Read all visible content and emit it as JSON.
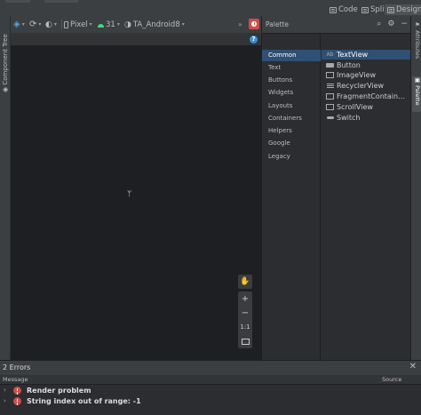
{
  "view_modes": {
    "code": "Code",
    "split": "Split",
    "design": "Design"
  },
  "toolbar": {
    "device": "Pixel",
    "api_level": "31",
    "theme": "TA_Android8",
    "overflow": "»"
  },
  "left_panel": {
    "label": "Component Tree"
  },
  "palette": {
    "title": "Palette",
    "categories": [
      "Common",
      "Text",
      "Buttons",
      "Widgets",
      "Layouts",
      "Containers",
      "Helpers",
      "Google",
      "Legacy"
    ],
    "items": [
      "TextView",
      "Button",
      "ImageView",
      "RecyclerView",
      "FragmentContain…",
      "ScrollView",
      "Switch"
    ],
    "textview_glyph": "Ab"
  },
  "right_panel": {
    "attributes": "Attributes",
    "palette": "Palette"
  },
  "zoom": {
    "pan": "✋",
    "zoom_in": "+",
    "zoom_out": "−",
    "actual_size": "1:1"
  },
  "problems": {
    "title": "2 Errors",
    "col_message": "Message",
    "col_source": "Source",
    "errors": [
      "Render problem",
      "String index out of range: -1"
    ]
  },
  "colors": {
    "error": "#c94f4f",
    "selection": "#2f4f73",
    "info": "#3d8fd6"
  }
}
